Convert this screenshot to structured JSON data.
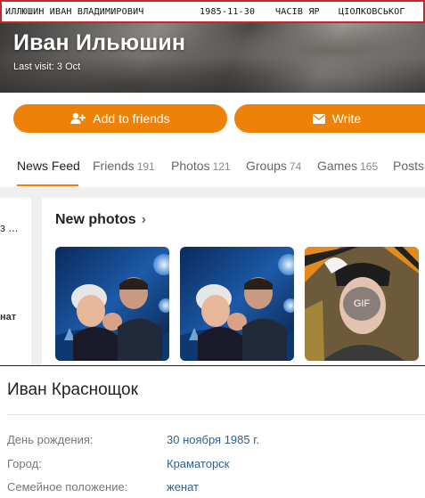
{
  "info_bar": {
    "name": "ИЛЛЮШИН ИВАН ВЛАДИМИРОВИЧ",
    "date": "1985-11-30",
    "place": "ЧАСІВ ЯР",
    "street": "ЦІОЛКОВСЬКОГ"
  },
  "profile": {
    "name": "Иван Ильюшин",
    "last_visit": "Last visit: 3 Oct"
  },
  "actions": {
    "add_friend_label": "Add to friends",
    "write_label": "Write"
  },
  "tabs": [
    {
      "label": "News Feed",
      "count": ""
    },
    {
      "label": "Friends",
      "count": "191"
    },
    {
      "label": "Photos",
      "count": "121"
    },
    {
      "label": "Groups",
      "count": "74"
    },
    {
      "label": "Games",
      "count": "165"
    },
    {
      "label": "Posts",
      "count": ""
    }
  ],
  "left_card": {
    "dots": "з ...",
    "fragment": "нат"
  },
  "new_photos": {
    "title": "New photos",
    "gif_label": "GIF"
  },
  "details": {
    "name": "Иван Краснощок",
    "fields": [
      {
        "label": "День рождения:",
        "value": "30 ноября 1985 г."
      },
      {
        "label": "Город:",
        "value": "Краматорск"
      },
      {
        "label": "Семейное положение:",
        "value": "женат"
      }
    ]
  },
  "colors": {
    "accent": "#ee8208",
    "info_border": "#c62828",
    "link": "#2f5f8f"
  }
}
